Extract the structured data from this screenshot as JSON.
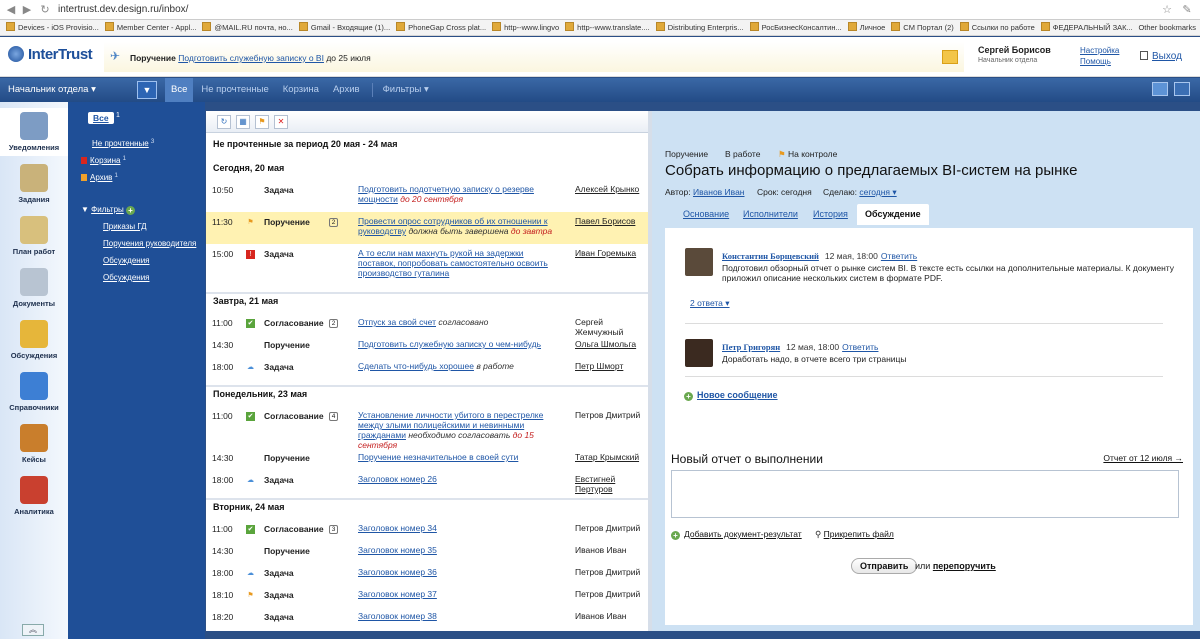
{
  "browser": {
    "url": "intertrust.dev.design.ru/inbox/",
    "bookmarks": [
      "Devices - iOS Provisio...",
      "Member Center - Appl...",
      "@MAIL.RU почта, но...",
      "Gmail - Входящие (1)...",
      "PhoneGap Cross plat...",
      "http--www.lingvo",
      "http--www.translate....",
      "Distributing Enterpris...",
      "РосБизнесКонсалтин...",
      "Личное",
      "CM Портал (2)",
      "Ссылки по работе",
      "ФЕДЕРАЛЬНЫЙ ЗАК..."
    ],
    "other_bookmarks": "Other bookmarks"
  },
  "header": {
    "logo": "InterTrust",
    "notice_type": "Поручение",
    "notice_link": "Подготовить служебную записку о BI",
    "notice_suffix": "до 25 июля",
    "user_name": "Сергей Борисов",
    "user_role": "Начальник отдела",
    "settings": "Настройка",
    "help": "Помощь",
    "exit": "Выход"
  },
  "nav": {
    "dept": "Начальник отдела ▾",
    "drop": "▼",
    "tabs": [
      "Все",
      "Не прочтенные",
      "Корзина",
      "Архив"
    ],
    "filters": "Фильтры ▾"
  },
  "rail": [
    {
      "label": "Уведомления",
      "color": "#7d9cc4"
    },
    {
      "label": "Задания",
      "color": "#c9b27a"
    },
    {
      "label": "План работ",
      "color": "#d8c07d"
    },
    {
      "label": "Документы",
      "color": "#b8c4d2"
    },
    {
      "label": "Обсуждения",
      "color": "#e6b63a"
    },
    {
      "label": "Справочники",
      "color": "#3d7fd4"
    },
    {
      "label": "Кейсы",
      "color": "#c97e2c"
    },
    {
      "label": "Аналитика",
      "color": "#c9402f"
    }
  ],
  "tree": {
    "all": "Все",
    "all_count": "1",
    "unread": "Не прочтенные",
    "unread_count": "3",
    "trash": "Корзина",
    "trash_count": "1",
    "archive": "Архив",
    "archive_count": "1",
    "filters": "Фильтры",
    "sub": [
      "Приказы ГД",
      "Поручения руководителя",
      "Обсуждения",
      "Обсуждения"
    ]
  },
  "list": {
    "period": "Не прочтенные за период 20 мая - 24 мая",
    "groups": [
      {
        "day": "Сегодня, 20 мая",
        "rows": [
          {
            "time": "10:50",
            "icon": "",
            "type": "Задача",
            "count": "",
            "subject": "Подготовить подотчетную записку о резерве мощности",
            "status": "",
            "deadline": "до 20 сентября",
            "person": "Алексей Крынко",
            "underline": true
          },
          {
            "time": "11:30",
            "icon": "flag",
            "type": "Поручение",
            "count": "2",
            "subject": "Провести опрос сотрудников об их отношении к руководству",
            "status": "должна быть завершена",
            "deadline": "до завтра",
            "person": "Павел Борисов",
            "underline": true,
            "hl": true
          },
          {
            "time": "15:00",
            "icon": "alert",
            "type": "Задача",
            "count": "",
            "subject": "А то если нам махнуть рукой на задержки поставок, попробовать самостоятельно освоить производство гуталина",
            "status": "",
            "deadline": "",
            "person": "Иван Горемыка",
            "underline": true
          }
        ]
      },
      {
        "day": "Завтра, 21 мая",
        "rows": [
          {
            "time": "11:00",
            "icon": "check",
            "type": "Согласование",
            "count": "2",
            "subject": "Отпуск за свой счет",
            "status": "согласовано",
            "deadline": "",
            "person": "Сергей Жемчужный",
            "underline": false
          },
          {
            "time": "14:30",
            "icon": "",
            "type": "Поручение",
            "count": "",
            "subject": "Подготовить служебную записку о чем-нибудь",
            "status": "",
            "deadline": "",
            "person": "Ольга Шмольга",
            "underline": true
          },
          {
            "time": "18:00",
            "icon": "cloud",
            "type": "Задача",
            "count": "",
            "subject": "Сделать что-нибудь хорошее",
            "status": "в работе",
            "deadline": "",
            "person": "Петр Шморт",
            "underline": true
          }
        ]
      },
      {
        "day": "Понедельник, 23 мая",
        "rows": [
          {
            "time": "11:00",
            "icon": "check",
            "type": "Согласование",
            "count": "4",
            "subject": "Установление личности убитого в перестрелке между злыми полицейскими и невинными гражданами",
            "status": "необходимо согласовать",
            "deadline": "до 15 сентября",
            "person": "Петров Дмитрий",
            "underline": false
          },
          {
            "time": "14:30",
            "icon": "",
            "type": "Поручение",
            "count": "",
            "subject": "Поручение незначительное в своей сути",
            "status": "",
            "deadline": "",
            "person": "Татар Крымский",
            "underline": true
          },
          {
            "time": "18:00",
            "icon": "cloud",
            "type": "Задача",
            "count": "",
            "subject": "Заголовок номер 26",
            "status": "",
            "deadline": "",
            "person": "Евстигней Пертуров",
            "underline": true
          }
        ]
      },
      {
        "day": "Вторник, 24 мая",
        "rows": [
          {
            "time": "11:00",
            "icon": "check",
            "type": "Согласование",
            "count": "3",
            "subject": "Заголовок номер 34",
            "status": "",
            "deadline": "",
            "person": "Петров Дмитрий",
            "underline": false
          },
          {
            "time": "14:30",
            "icon": "",
            "type": "Поручение",
            "count": "",
            "subject": "Заголовок номер 35",
            "status": "",
            "deadline": "",
            "person": "Иванов Иван",
            "underline": false
          },
          {
            "time": "18:00",
            "icon": "cloud",
            "type": "Задача",
            "count": "",
            "subject": "Заголовок номер 36",
            "status": "",
            "deadline": "",
            "person": "Петров Дмитрий",
            "underline": false
          },
          {
            "time": "18:10",
            "icon": "flag",
            "type": "Задача",
            "count": "",
            "subject": "Заголовок номер 37",
            "status": "",
            "deadline": "",
            "person": "Петров Дмитрий",
            "underline": false
          },
          {
            "time": "18:20",
            "icon": "",
            "type": "Задача",
            "count": "",
            "subject": "Заголовок номер 38",
            "status": "",
            "deadline": "",
            "person": "Иванов Иван",
            "underline": false
          }
        ]
      }
    ]
  },
  "detail": {
    "kind": "Поручение",
    "state": "В работе",
    "control": "На контроле",
    "title": "Собрать информацию о предлагаемых BI-систем на рынке",
    "author_label": "Автор:",
    "author": "Иванов Иван",
    "term_label": "Срок: сегодня",
    "done_label": "Сделаю:",
    "done_value": "сегодня ▾",
    "tabs": [
      "Основание",
      "Исполнители",
      "История",
      "Обсуждение"
    ],
    "comments": [
      {
        "author": "Константин Борщевский",
        "time": "12 мая, 18:00",
        "reply": "Ответить",
        "text": "Подготовил обзорный отчет о рынке систем BI. В тексте есть ссылки на дополнительные материалы. К документу приложил описание нескольких систем в формате PDF."
      },
      {
        "author": "Петр Григорян",
        "time": "12 мая, 18:00",
        "reply": "Ответить",
        "text": "Доработать надо, в отчете всего три страницы"
      }
    ],
    "replies": "2 ответа ▾",
    "new_message": "Новое сообщение",
    "report_title": "Новый отчет о выполнении",
    "report_link": "Отчет от 12 июля →",
    "add_doc": "Добавить документ-результат",
    "attach": "Прикрепить файл",
    "send": "Отправить",
    "or": "или",
    "reassign": "перепоручить"
  }
}
